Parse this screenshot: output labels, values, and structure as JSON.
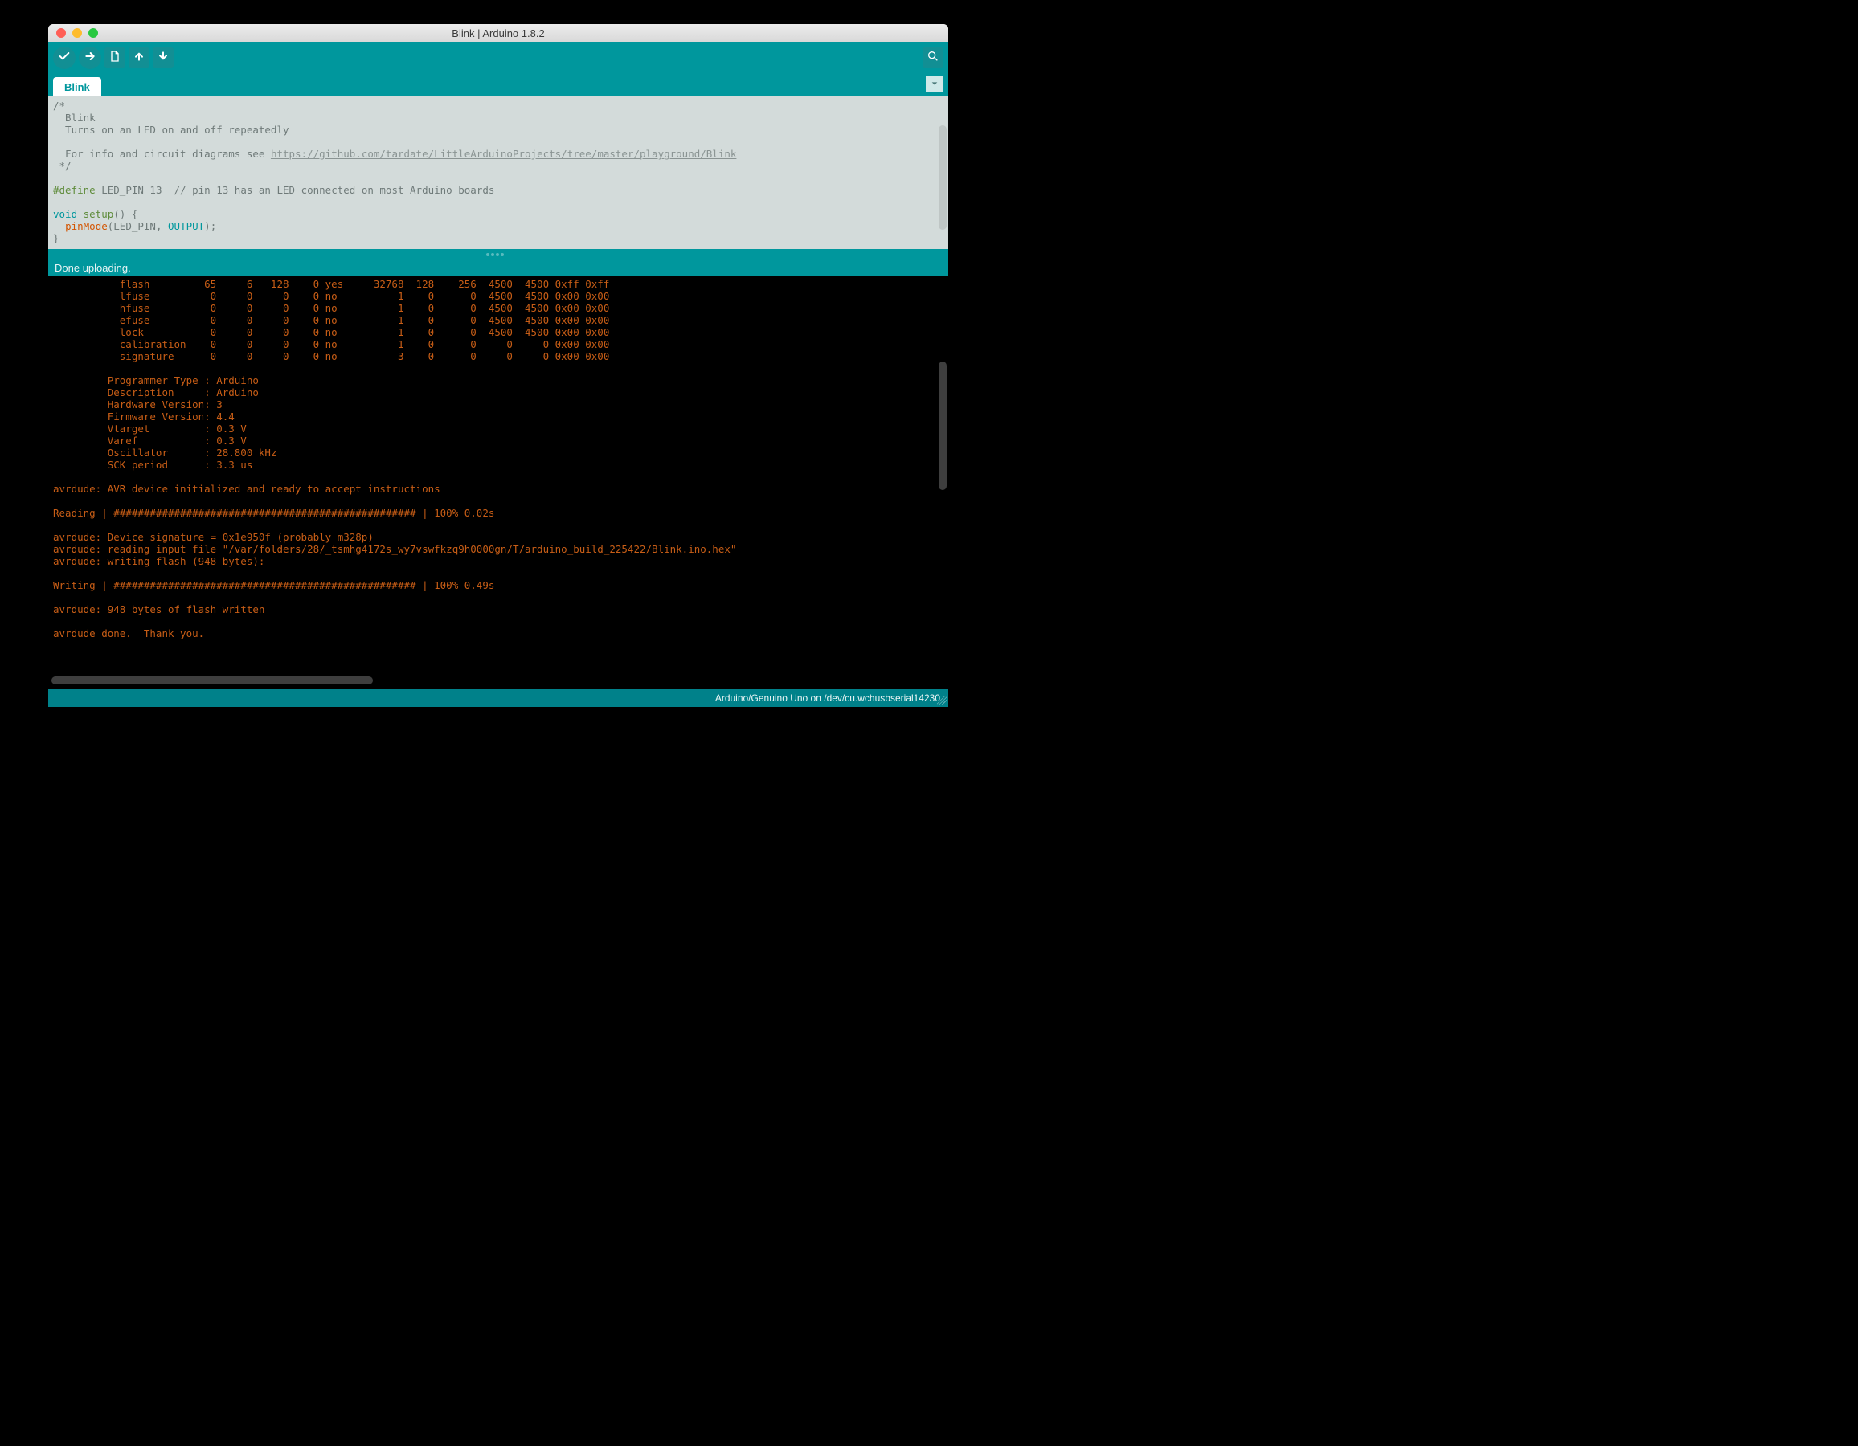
{
  "window": {
    "title": "Blink | Arduino 1.8.2"
  },
  "tab": {
    "label": "Blink"
  },
  "status": {
    "message": "Done uploading."
  },
  "footer": {
    "board_port": "Arduino/Genuino Uno on /dev/cu.wchusbserial14230"
  },
  "code": {
    "c1": "/*",
    "c2": "  Blink",
    "c3": "  Turns on an LED on and off repeatedly",
    "c4": "",
    "c5_pre": "  For info and circuit diagrams see ",
    "c5_link": "https://github.com/tardate/LittleArduinoProjects/tree/master/playground/Blink",
    "c6": " */",
    "def_kw": "#define",
    "def_rest": " LED_PIN 13  ",
    "def_comment": "// pin 13 has an LED connected on most Arduino boards",
    "void": "void",
    "setup": " setup",
    "setup_paren": "() {",
    "pinmode": "pinMode",
    "pin_args_open": "(LED_PIN, ",
    "output": "OUTPUT",
    "pin_args_close": ");",
    "brace": "}"
  },
  "console": {
    "text": "           flash         65     6   128    0 yes     32768  128    256  4500  4500 0xff 0xff\n           lfuse          0     0     0    0 no          1    0      0  4500  4500 0x00 0x00\n           hfuse          0     0     0    0 no          1    0      0  4500  4500 0x00 0x00\n           efuse          0     0     0    0 no          1    0      0  4500  4500 0x00 0x00\n           lock           0     0     0    0 no          1    0      0  4500  4500 0x00 0x00\n           calibration    0     0     0    0 no          1    0      0     0     0 0x00 0x00\n           signature      0     0     0    0 no          3    0      0     0     0 0x00 0x00\n\n         Programmer Type : Arduino\n         Description     : Arduino\n         Hardware Version: 3\n         Firmware Version: 4.4\n         Vtarget         : 0.3 V\n         Varef           : 0.3 V\n         Oscillator      : 28.800 kHz\n         SCK period      : 3.3 us\n\navrdude: AVR device initialized and ready to accept instructions\n\nReading | ################################################## | 100% 0.02s\n\navrdude: Device signature = 0x1e950f (probably m328p)\navrdude: reading input file \"/var/folders/28/_tsmhg4172s_wy7vswfkzq9h0000gn/T/arduino_build_225422/Blink.ino.hex\"\navrdude: writing flash (948 bytes):\n\nWriting | ################################################## | 100% 0.49s\n\navrdude: 948 bytes of flash written\n\navrdude done.  Thank you.\n"
  },
  "icons": {
    "verify": "verify",
    "upload": "upload",
    "new": "new",
    "open": "open",
    "save": "save",
    "serial": "serial-monitor"
  }
}
